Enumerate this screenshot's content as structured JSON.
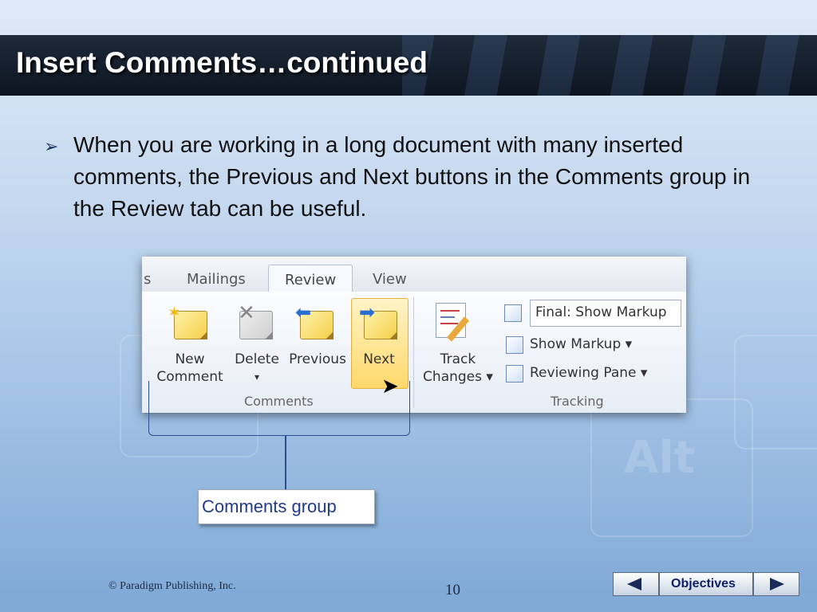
{
  "slide": {
    "title": "Insert Comments…continued",
    "bullet_text": "When you are working in a long document with many inserted comments, the Previous and Next buttons in the Comments group in the Review tab can be useful."
  },
  "ribbon": {
    "tabs": {
      "partial": "s",
      "mailings": "Mailings",
      "review": "Review",
      "view": "View"
    },
    "comments_group": {
      "label": "Comments",
      "new_comment_line1": "New",
      "new_comment_line2": "Comment",
      "delete_label": "Delete",
      "delete_arrow": "▾",
      "previous_label": "Previous",
      "next_label": "Next"
    },
    "tracking_group": {
      "label": "Tracking",
      "track_changes_line1": "Track",
      "track_changes_line2": "Changes ▾",
      "display_dropdown": "Final: Show Markup",
      "show_markup": "Show Markup ▾",
      "reviewing_pane": "Reviewing Pane ▾"
    }
  },
  "callout": {
    "label": "Comments group"
  },
  "footer": {
    "copyright": "© Paradigm Publishing, Inc.",
    "page_number": "10",
    "objectives_label": "Objectives"
  },
  "colors": {
    "title_bar": "#111a26",
    "title_text": "#ffffff",
    "callout_text": "#1f3b8c",
    "nav_text": "#0f1f66"
  },
  "icons": [
    "bullet-arrow-icon",
    "new-comment-icon",
    "delete-comment-icon",
    "previous-comment-icon",
    "next-comment-icon",
    "track-changes-icon",
    "mouse-cursor-icon",
    "prev-slide-icon",
    "next-slide-icon"
  ]
}
